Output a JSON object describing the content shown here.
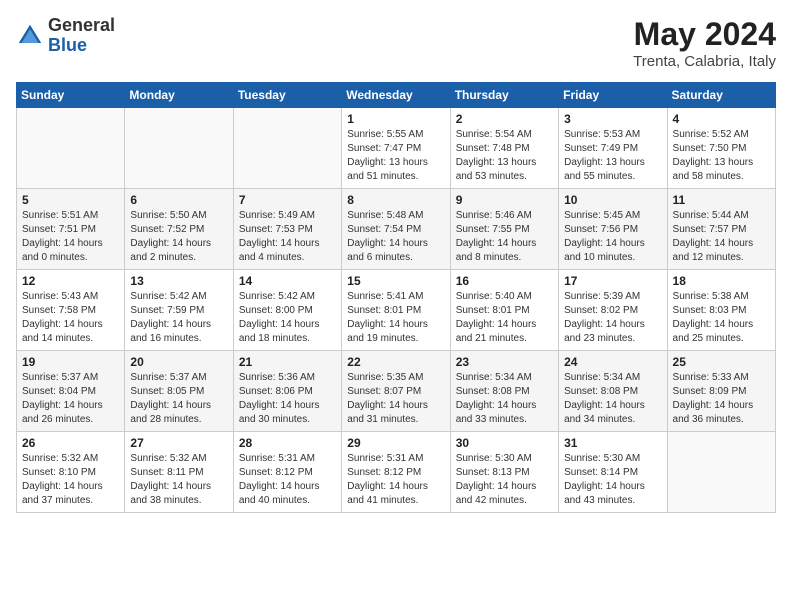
{
  "header": {
    "logo_general": "General",
    "logo_blue": "Blue",
    "month_year": "May 2024",
    "location": "Trenta, Calabria, Italy"
  },
  "weekdays": [
    "Sunday",
    "Monday",
    "Tuesday",
    "Wednesday",
    "Thursday",
    "Friday",
    "Saturday"
  ],
  "weeks": [
    [
      {
        "day": "",
        "info": ""
      },
      {
        "day": "",
        "info": ""
      },
      {
        "day": "",
        "info": ""
      },
      {
        "day": "1",
        "info": "Sunrise: 5:55 AM\nSunset: 7:47 PM\nDaylight: 13 hours\nand 51 minutes."
      },
      {
        "day": "2",
        "info": "Sunrise: 5:54 AM\nSunset: 7:48 PM\nDaylight: 13 hours\nand 53 minutes."
      },
      {
        "day": "3",
        "info": "Sunrise: 5:53 AM\nSunset: 7:49 PM\nDaylight: 13 hours\nand 55 minutes."
      },
      {
        "day": "4",
        "info": "Sunrise: 5:52 AM\nSunset: 7:50 PM\nDaylight: 13 hours\nand 58 minutes."
      }
    ],
    [
      {
        "day": "5",
        "info": "Sunrise: 5:51 AM\nSunset: 7:51 PM\nDaylight: 14 hours\nand 0 minutes."
      },
      {
        "day": "6",
        "info": "Sunrise: 5:50 AM\nSunset: 7:52 PM\nDaylight: 14 hours\nand 2 minutes."
      },
      {
        "day": "7",
        "info": "Sunrise: 5:49 AM\nSunset: 7:53 PM\nDaylight: 14 hours\nand 4 minutes."
      },
      {
        "day": "8",
        "info": "Sunrise: 5:48 AM\nSunset: 7:54 PM\nDaylight: 14 hours\nand 6 minutes."
      },
      {
        "day": "9",
        "info": "Sunrise: 5:46 AM\nSunset: 7:55 PM\nDaylight: 14 hours\nand 8 minutes."
      },
      {
        "day": "10",
        "info": "Sunrise: 5:45 AM\nSunset: 7:56 PM\nDaylight: 14 hours\nand 10 minutes."
      },
      {
        "day": "11",
        "info": "Sunrise: 5:44 AM\nSunset: 7:57 PM\nDaylight: 14 hours\nand 12 minutes."
      }
    ],
    [
      {
        "day": "12",
        "info": "Sunrise: 5:43 AM\nSunset: 7:58 PM\nDaylight: 14 hours\nand 14 minutes."
      },
      {
        "day": "13",
        "info": "Sunrise: 5:42 AM\nSunset: 7:59 PM\nDaylight: 14 hours\nand 16 minutes."
      },
      {
        "day": "14",
        "info": "Sunrise: 5:42 AM\nSunset: 8:00 PM\nDaylight: 14 hours\nand 18 minutes."
      },
      {
        "day": "15",
        "info": "Sunrise: 5:41 AM\nSunset: 8:01 PM\nDaylight: 14 hours\nand 19 minutes."
      },
      {
        "day": "16",
        "info": "Sunrise: 5:40 AM\nSunset: 8:01 PM\nDaylight: 14 hours\nand 21 minutes."
      },
      {
        "day": "17",
        "info": "Sunrise: 5:39 AM\nSunset: 8:02 PM\nDaylight: 14 hours\nand 23 minutes."
      },
      {
        "day": "18",
        "info": "Sunrise: 5:38 AM\nSunset: 8:03 PM\nDaylight: 14 hours\nand 25 minutes."
      }
    ],
    [
      {
        "day": "19",
        "info": "Sunrise: 5:37 AM\nSunset: 8:04 PM\nDaylight: 14 hours\nand 26 minutes."
      },
      {
        "day": "20",
        "info": "Sunrise: 5:37 AM\nSunset: 8:05 PM\nDaylight: 14 hours\nand 28 minutes."
      },
      {
        "day": "21",
        "info": "Sunrise: 5:36 AM\nSunset: 8:06 PM\nDaylight: 14 hours\nand 30 minutes."
      },
      {
        "day": "22",
        "info": "Sunrise: 5:35 AM\nSunset: 8:07 PM\nDaylight: 14 hours\nand 31 minutes."
      },
      {
        "day": "23",
        "info": "Sunrise: 5:34 AM\nSunset: 8:08 PM\nDaylight: 14 hours\nand 33 minutes."
      },
      {
        "day": "24",
        "info": "Sunrise: 5:34 AM\nSunset: 8:08 PM\nDaylight: 14 hours\nand 34 minutes."
      },
      {
        "day": "25",
        "info": "Sunrise: 5:33 AM\nSunset: 8:09 PM\nDaylight: 14 hours\nand 36 minutes."
      }
    ],
    [
      {
        "day": "26",
        "info": "Sunrise: 5:32 AM\nSunset: 8:10 PM\nDaylight: 14 hours\nand 37 minutes."
      },
      {
        "day": "27",
        "info": "Sunrise: 5:32 AM\nSunset: 8:11 PM\nDaylight: 14 hours\nand 38 minutes."
      },
      {
        "day": "28",
        "info": "Sunrise: 5:31 AM\nSunset: 8:12 PM\nDaylight: 14 hours\nand 40 minutes."
      },
      {
        "day": "29",
        "info": "Sunrise: 5:31 AM\nSunset: 8:12 PM\nDaylight: 14 hours\nand 41 minutes."
      },
      {
        "day": "30",
        "info": "Sunrise: 5:30 AM\nSunset: 8:13 PM\nDaylight: 14 hours\nand 42 minutes."
      },
      {
        "day": "31",
        "info": "Sunrise: 5:30 AM\nSunset: 8:14 PM\nDaylight: 14 hours\nand 43 minutes."
      },
      {
        "day": "",
        "info": ""
      }
    ]
  ]
}
